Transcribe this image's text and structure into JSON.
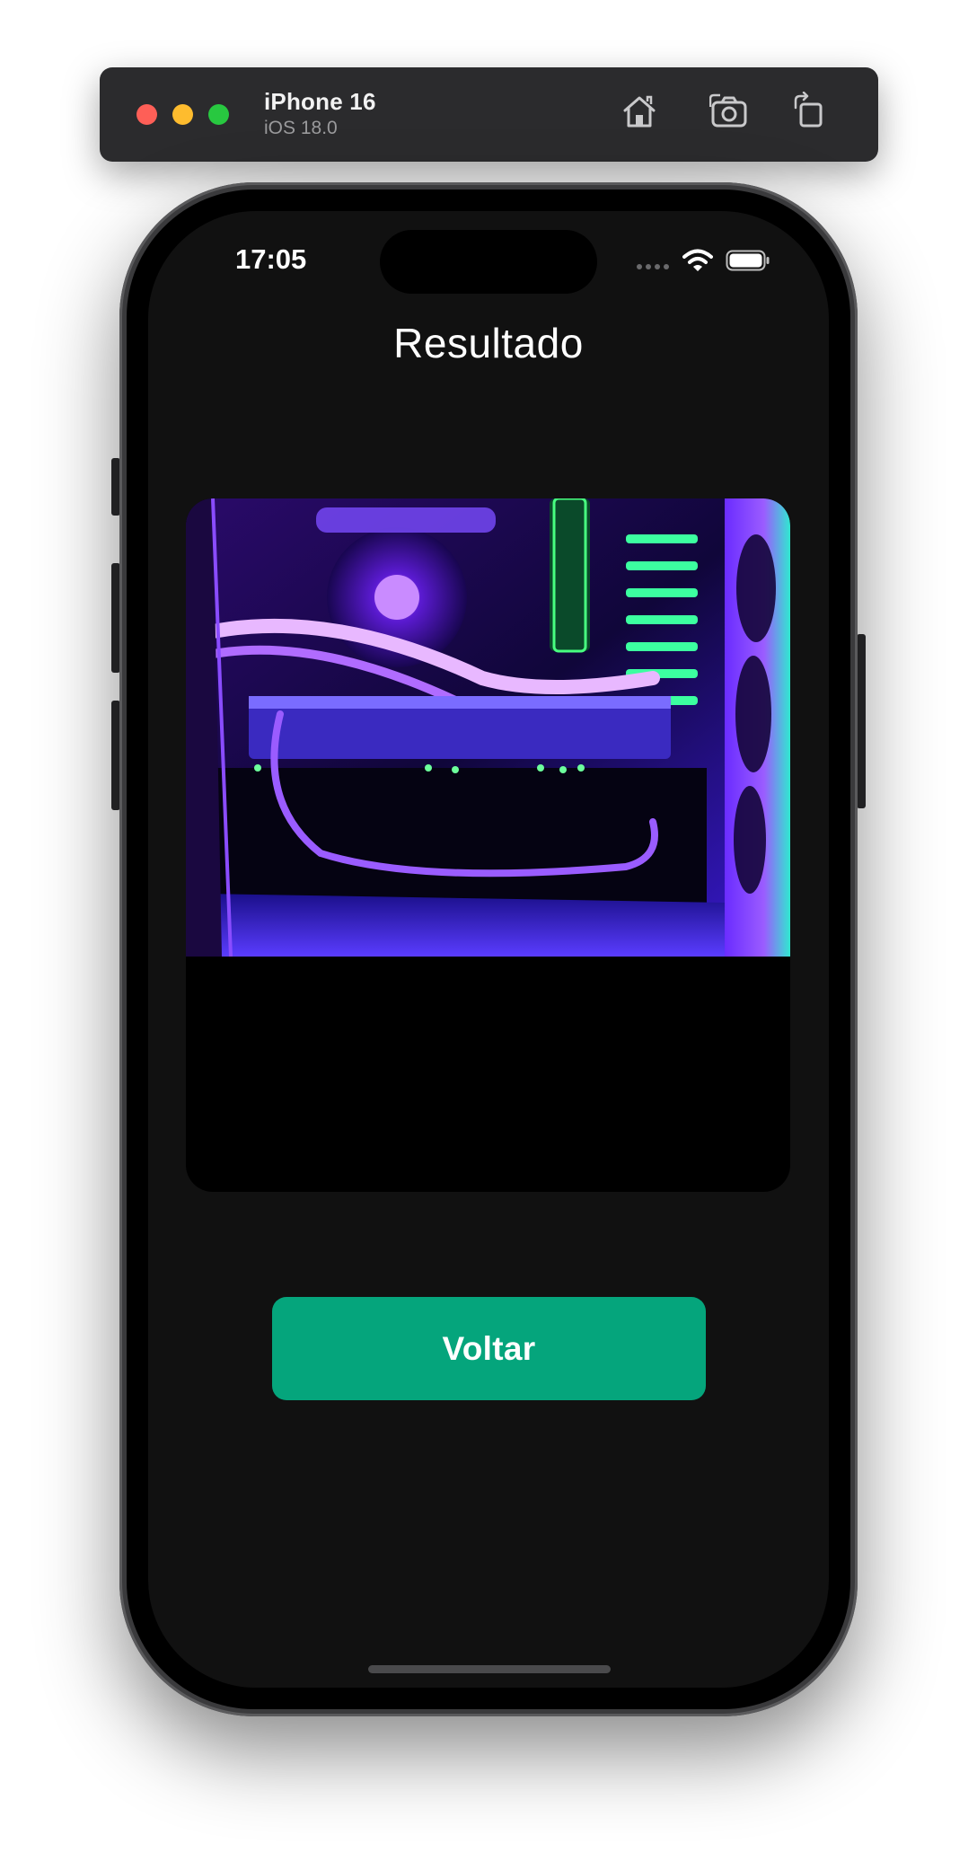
{
  "simulator": {
    "device_name": "iPhone 16",
    "os_version": "iOS 18.0",
    "icons": [
      "home-icon",
      "screenshot-icon",
      "rotate-icon"
    ]
  },
  "status_bar": {
    "time": "17:05",
    "icons": [
      "signal-dots-icon",
      "wifi-icon",
      "battery-icon"
    ]
  },
  "screen": {
    "title": "Resultado",
    "image": {
      "subject": "PC interior with purple and green RGB lighting"
    },
    "button_label": "Voltar"
  },
  "colors": {
    "screen_bg": "#111111",
    "card_bg": "#000000",
    "button_bg": "#05a57c",
    "text": "#ffffff"
  }
}
